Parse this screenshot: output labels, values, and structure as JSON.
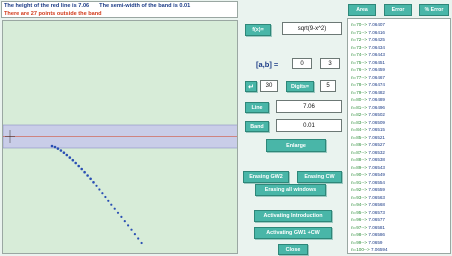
{
  "info": {
    "red_line_text": "The height of the red line is 7.06",
    "semi_width_text": "The semi-width of the band is 0.01",
    "outside_text": "There are 27 points outside the band"
  },
  "controls": {
    "func_button": "f(x)=",
    "func_value": "sqrt(9-x^2)",
    "interval_label": "[a,b] =",
    "a_value": "0",
    "b_value": "3",
    "n_button": "↵",
    "n_value": "30",
    "digits_button": "Digits=",
    "digits_value": "5",
    "line_button": "Line",
    "line_value": "7.06",
    "band_button": "Band",
    "band_value": "0.01",
    "enlarge_button": "Enlarge",
    "erasing_gw2_button": "Erasing GW2",
    "erasing_cw_button": "Erasing CW",
    "erasing_all_button": "Erasing all windows",
    "activating_intro_button": "Activating Introduction",
    "activating_gw1_button": "Activating GW1 +CW",
    "close_button": "Close"
  },
  "tabs": {
    "area": "Area",
    "error": "Error",
    "pct_error": "% Error"
  },
  "list_rows": [
    {
      "n": "n=70-->",
      "v": "7.06407"
    },
    {
      "n": "n=71-->",
      "v": "7.06416"
    },
    {
      "n": "n=72-->",
      "v": "7.06425"
    },
    {
      "n": "n=73-->",
      "v": "7.06434"
    },
    {
      "n": "n=74-->",
      "v": "7.06443"
    },
    {
      "n": "n=75-->",
      "v": "7.06451"
    },
    {
      "n": "n=76-->",
      "v": "7.06459"
    },
    {
      "n": "n=77-->",
      "v": "7.06467"
    },
    {
      "n": "n=78-->",
      "v": "7.06474"
    },
    {
      "n": "n=79-->",
      "v": "7.06482"
    },
    {
      "n": "n=80-->",
      "v": "7.06489"
    },
    {
      "n": "n=81-->",
      "v": "7.06496"
    },
    {
      "n": "n=82-->",
      "v": "7.06502"
    },
    {
      "n": "n=83-->",
      "v": "7.06509"
    },
    {
      "n": "n=84-->",
      "v": "7.06515"
    },
    {
      "n": "n=85-->",
      "v": "7.06521"
    },
    {
      "n": "n=86-->",
      "v": "7.06527"
    },
    {
      "n": "n=87-->",
      "v": "7.06532"
    },
    {
      "n": "n=88-->",
      "v": "7.06538"
    },
    {
      "n": "n=89-->",
      "v": "7.06543"
    },
    {
      "n": "n=90-->",
      "v": "7.06549"
    },
    {
      "n": "n=91-->",
      "v": "7.06554"
    },
    {
      "n": "n=92-->",
      "v": "7.06559"
    },
    {
      "n": "n=93-->",
      "v": "7.06563"
    },
    {
      "n": "n=94-->",
      "v": "7.06568"
    },
    {
      "n": "n=95-->",
      "v": "7.06573"
    },
    {
      "n": "n=96-->",
      "v": "7.06577"
    },
    {
      "n": "n=97-->",
      "v": "7.06581"
    },
    {
      "n": "n=98-->",
      "v": "7.06586"
    },
    {
      "n": "n=99-->",
      "v": "7.0659"
    },
    {
      "n": "n=100-->",
      "v": "7.06594"
    }
  ],
  "colors": {
    "plot_bg": "#d7ecd8",
    "band": "#c9cde8",
    "red_line": "#d23a1a",
    "points": "#2a4fb3",
    "button": "#49b6a8",
    "list_index": "#2f8f3c",
    "list_value": "#1b3b86"
  }
}
